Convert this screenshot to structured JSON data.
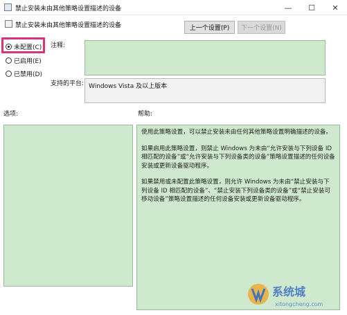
{
  "window": {
    "title": "禁止安装未由其他策略设置描述的设备",
    "controls": {
      "minimize": "—",
      "maximize": "☐",
      "close": "✕"
    }
  },
  "header": {
    "policy_name": "禁止安装未由其他策略设置描述的设备"
  },
  "nav": {
    "prev_label": "上一个设置(P)",
    "next_label": "下一个设置(N)"
  },
  "radios": [
    {
      "label": "未配置(C)",
      "checked": true
    },
    {
      "label": "已启用(E)",
      "checked": false
    },
    {
      "label": "已禁用(D)",
      "checked": false
    }
  ],
  "comment": {
    "label": "注释:",
    "value": ""
  },
  "platform": {
    "label": "支持的平台:",
    "value": "Windows Vista 及以上版本"
  },
  "options": {
    "label": "选项:"
  },
  "help": {
    "label": "帮助:",
    "paragraphs": [
      "使用此策略设置，可以禁止安装未由任何其他策略设置明确描述的设备。",
      "如果启用此策略设置，则禁止 Windows 为未由“允许安装与下列设备 ID 相匹配的设备”或“允许安装与下列设备类的设备”策略设置描述的任何设备安装或更新设备驱动程序。",
      "如果禁用或未配置此策略设置，则允许 Windows 为未由“禁止安装与下列设备 ID 相匹配的设备”、“禁止安装下列设备类的设备”或“禁止安装可移动设备”策略设置描述的任何设备安装或更新设备驱动程序。"
    ]
  },
  "watermark": {
    "brand": "系统城",
    "url": "xitongcheng.com"
  },
  "colors": {
    "green_panel": "#cfe9cf",
    "highlight": "#d9327c"
  }
}
